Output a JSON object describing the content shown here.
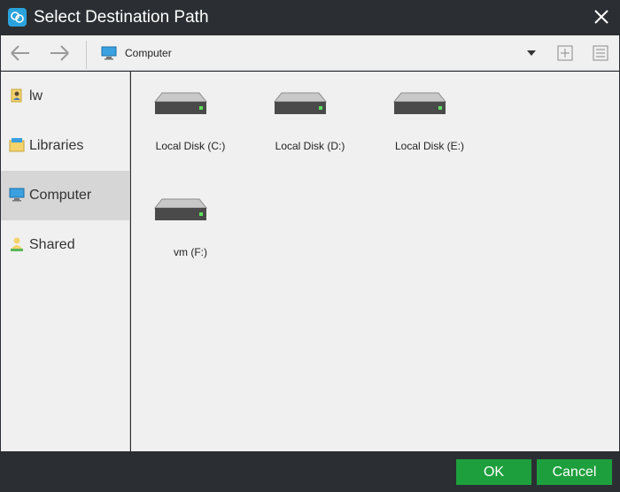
{
  "window": {
    "title": "Select Destination Path"
  },
  "toolbar": {
    "path": "Computer"
  },
  "sidebar": {
    "items": [
      {
        "label": "lw",
        "icon": "user-folder-icon"
      },
      {
        "label": "Libraries",
        "icon": "libraries-icon"
      },
      {
        "label": "Computer",
        "icon": "computer-icon",
        "selected": true
      },
      {
        "label": "Shared",
        "icon": "shared-user-icon"
      }
    ]
  },
  "drives": [
    {
      "label": "Local Disk (C:)"
    },
    {
      "label": "Local Disk (D:)"
    },
    {
      "label": "Local Disk (E:)"
    },
    {
      "label": "vm (F:)"
    }
  ],
  "footer": {
    "ok_label": "OK",
    "cancel_label": "Cancel"
  },
  "colors": {
    "chrome": "#2b2f33",
    "panel": "#f0f0f0",
    "selected": "#d6d6d6",
    "accent": "#1e9f3d",
    "app_icon": "#2aa3dc"
  }
}
